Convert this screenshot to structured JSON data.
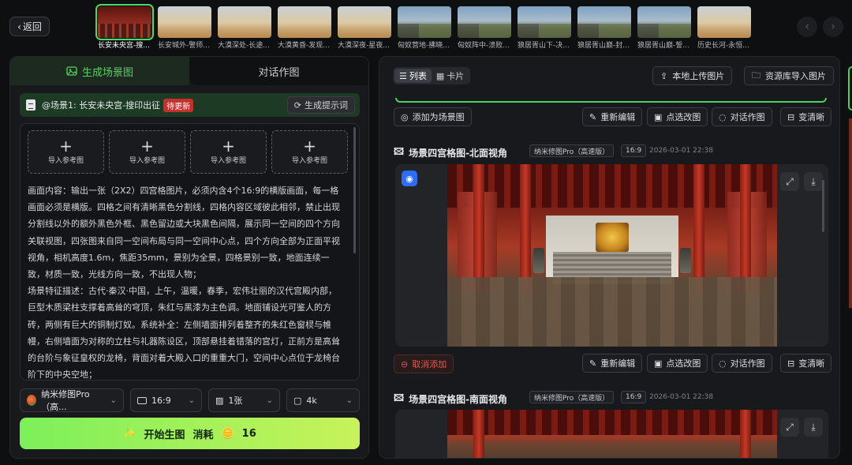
{
  "back_label": "返回",
  "thumbnails": [
    {
      "label": "长安未央宫-搜...",
      "kind": "hall",
      "active": true
    },
    {
      "label": "长安城外-警师...",
      "kind": "desert"
    },
    {
      "label": "大漠深处-长途...",
      "kind": "desert"
    },
    {
      "label": "大漠黄昏-发现...",
      "kind": "desert"
    },
    {
      "label": "大漠深夜-星夜...",
      "kind": "desert"
    },
    {
      "label": "匈奴营地-拂晓...",
      "kind": "mount"
    },
    {
      "label": "匈奴阵中-溃败...",
      "kind": "mount"
    },
    {
      "label": "狼居胥山下-决...",
      "kind": "mount"
    },
    {
      "label": "狼居胥山巅-封...",
      "kind": "mount"
    },
    {
      "label": "狼居胥山巅-誓...",
      "kind": "mount"
    },
    {
      "label": "历史长河-永恒...",
      "kind": "desert"
    }
  ],
  "left": {
    "tab_generate": "生成场景图",
    "tab_dialog": "对话作图",
    "scene_label": "@场景1: 长安未央宫-搜印出征",
    "scene_badge": "待更新",
    "gen_prompt_btn": "生成提示词",
    "ref_label": "导入参考图",
    "prompt": "画面内容：输出一张（2X2）四宫格图片，必须内含4个16:9的横版画面，每一格画面必须是横版。四格之间有清晰黑色分割线，四格内容区域彼此相邻，禁止出现分割线以外的额外黑色外框、黑色留边或大块黑色间隔，展示同一空间的四个方向关联视图，四张图来自同一空间布局与同一空间中心点，四个方向全部为正面平视视角，相机高度1.6m，焦距35mm，景别为全景，四格景别一致，地面连续一致，材质一致，光线方向一致，不出现人物；\n场景特征描述：古代·秦汉·中国，上午，温暖，春季，宏伟壮丽的汉代宫殿内部，巨型木质梁柱支撑着高耸的穹顶，朱红与黑漆为主色调。地面铺设光可鉴人的方砖，两侧有巨大的铜制灯奴。系统补全：左侧墙面排列着整齐的朱红色窗棂与帷幔，右侧墙面为对称的立柱与礼器陈设区，顶部悬挂着错落的宫灯，正前方是高耸的台阶与象征皇权的龙椅，背面对着大殿入口的重重大门，空间中心点位于龙椅台阶下的中央空地；\n四个视角：",
    "model": "纳米修图Pro（高...",
    "ratio": "16:9",
    "count": "1张",
    "resolution": "4k",
    "generate_label": "开始生图",
    "cost_label": "消耗",
    "cost_value": "16"
  },
  "right": {
    "view_list": "列表",
    "view_card": "卡片",
    "upload_local": "本地上传图片",
    "import_library": "资源库导入图片",
    "add_as_scene": "添加为场景图",
    "cancel_add": "取消添加",
    "regen": "重新编辑",
    "point_edit": "点选改图",
    "dialog_edit": "对话作图",
    "sharpen": "变清晰",
    "cards": [
      {
        "title": "场景四宫格图-北面视角",
        "model": "纳米修图Pro（高速版）",
        "ratio": "16:9",
        "date": "2026-03-01 22:38"
      },
      {
        "title": "场景四宫格图-南面视角",
        "model": "纳米修图Pro（高速版）",
        "ratio": "16:9",
        "date": "2026-03-01 22:38"
      }
    ]
  }
}
